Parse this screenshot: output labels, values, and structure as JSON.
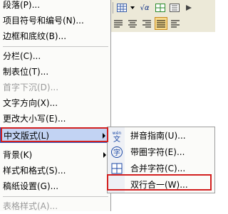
{
  "format_menu": {
    "items": [
      {
        "label": "段落(P)...",
        "disabled": false
      },
      {
        "label": "项目符号和编号(N)...",
        "disabled": false
      },
      {
        "label": "边框和底纹(B)...",
        "disabled": false
      },
      {
        "label": "分栏(C)...",
        "disabled": false
      },
      {
        "label": "制表位(T)...",
        "disabled": false
      },
      {
        "label": "首字下沉(D)...",
        "disabled": true
      },
      {
        "label": "文字方向(X)...",
        "disabled": false
      },
      {
        "label": "更改大小写(E)...",
        "disabled": false
      },
      {
        "label": "中文版式(L)",
        "disabled": false
      },
      {
        "label": "背景(K)",
        "disabled": false
      },
      {
        "label": "样式和格式(S)...",
        "disabled": false
      },
      {
        "label": "稿纸设置(G)...",
        "disabled": false
      },
      {
        "label": "表格样式(A)...",
        "disabled": true
      }
    ]
  },
  "toolbar": {
    "row1_icons": [
      "table-icon",
      "chevron-down-icon",
      "formula-icon",
      "grid-icon",
      "list-icon",
      "arrow-icon"
    ],
    "row2_icons": [
      "align-justify-icon",
      "align-center-icon",
      "align-right-icon",
      "align-distributed-icon",
      "align-left-icon"
    ],
    "formula_text": "√α",
    "pressed_color": "#f6d98a"
  },
  "submenu": {
    "items": [
      {
        "label": "拼音指南(U)...",
        "icon": "wen-pinyin-icon",
        "icon_text": "wén\n文"
      },
      {
        "label": "带圈字符(E)...",
        "icon": "enclosed-char-icon",
        "icon_text": "字"
      },
      {
        "label": "合并字符(C)...",
        "icon": "combine-chars-icon",
        "icon_text": "⊞"
      },
      {
        "label": "双行合一(W)...",
        "icon": "two-lines-in-one-icon",
        "icon_text": ""
      }
    ]
  },
  "colors": {
    "menu_bg": "#fbfbf9",
    "active_bg": "#c2d3f3",
    "active_border": "#2f5fc9",
    "highlight_red": "#d21f1f",
    "disabled_text": "#9a9a9a"
  }
}
